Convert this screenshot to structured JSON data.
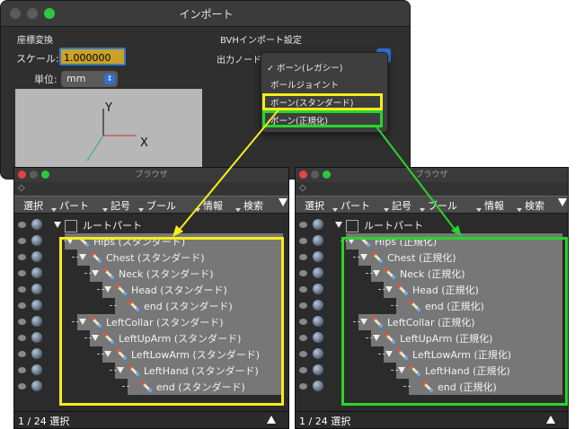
{
  "dialog": {
    "title": "インポート",
    "coord_section": "座標変換",
    "scale_label": "スケール:",
    "scale_value": "1.000000",
    "unit_label": "単位:",
    "unit_value": "mm",
    "bvh_section": "BVHインポート設定",
    "output_node_label": "出力ノード:",
    "axis_y": "Y",
    "axis_x": "X"
  },
  "menu": {
    "items": [
      {
        "label": "ボーン(レガシー)",
        "checked": true
      },
      {
        "label": "ボールジョイント",
        "checked": false
      },
      {
        "label": "ボーン(スタンダード)",
        "checked": false,
        "highlight": "#f5ee1c"
      },
      {
        "label": "ボーン(正規化)",
        "checked": false,
        "highlight": "#27d62a"
      }
    ],
    "check_mark": "✓"
  },
  "browsers": [
    {
      "title": "ブラウザ",
      "menus": [
        "選択",
        "パート",
        "記号",
        "ブール",
        "情報",
        "検索"
      ],
      "root": "ルートパート",
      "nodes": [
        "Hips (スタンダード)",
        "Chest (スタンダード)",
        "Neck (スタンダード)",
        "Head (スタンダード)",
        "end (スタンダード)",
        "LeftCollar (スタンダード)",
        "LeftUpArm (スタンダード)",
        "LeftLowArm (スタンダード)",
        "LeftHand (スタンダード)",
        "end (スタンダード)"
      ],
      "status": "1 / 24 選択",
      "frame_color": "#f5ee1c"
    },
    {
      "title": "ブラウザ",
      "menus": [
        "選択",
        "パート",
        "記号",
        "ブール",
        "情報",
        "検索"
      ],
      "root": "ルートパート",
      "nodes": [
        "Hips (正規化)",
        "Chest (正規化)",
        "Neck (正規化)",
        "Head (正規化)",
        "end (正規化)",
        "LeftCollar (正規化)",
        "LeftUpArm (正規化)",
        "LeftLowArm (正規化)",
        "LeftHand (正規化)",
        "end (正規化)"
      ],
      "status": "1 / 24 選択",
      "frame_color": "#27d62a"
    }
  ]
}
